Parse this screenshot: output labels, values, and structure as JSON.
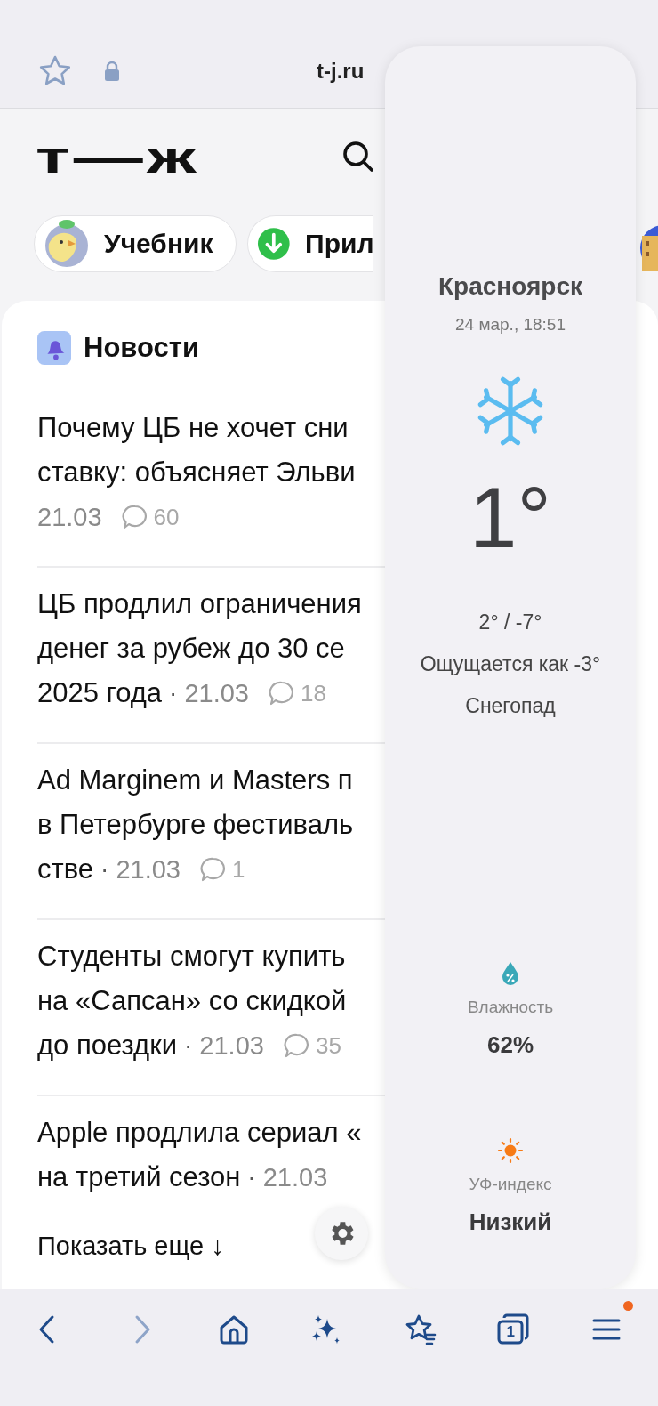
{
  "address_bar": {
    "url": "t-j.ru"
  },
  "header": {
    "logo": "т—ж"
  },
  "chips": [
    {
      "label": "Учебник",
      "kind": "avatar"
    },
    {
      "label": "Прил",
      "kind": "download"
    },
    {
      "kind": "partial"
    }
  ],
  "news": {
    "title": "Новости",
    "items": [
      {
        "lines": [
          "Почему ЦБ не хочет сни",
          "ставку: объясняет Эльви"
        ],
        "date": "21.03",
        "comments": "60"
      },
      {
        "lines": [
          "ЦБ продлил ограничения",
          "денег за рубеж до 30 се"
        ],
        "tail": "2025 года",
        "separator": "·",
        "date": "21.03",
        "comments": "18"
      },
      {
        "lines": [
          "Ad Marginem и Masters п",
          "в Петербурге фестиваль"
        ],
        "tail": "стве",
        "separator": "·",
        "date": "21.03",
        "comments": "1"
      },
      {
        "lines": [
          "Студенты смогут купить",
          "на «Сапсан» со скидкой"
        ],
        "tail": "до поездки",
        "separator": "·",
        "date": "21.03",
        "comments": "35"
      },
      {
        "lines": [
          "Apple продлила сериал «"
        ],
        "tail": "на третий сезон",
        "separator": "·",
        "date": "21.03"
      }
    ],
    "more": "Показать еще ↓"
  },
  "weather": {
    "city": "Красноярск",
    "time": "24 мар., 18:51",
    "temperature": "1°",
    "range": "2° / -7°",
    "feels_like": "Ощущается как -3°",
    "condition": "Снегопад",
    "details": [
      {
        "kind": "humidity",
        "label": "Влажность",
        "value": "62%"
      },
      {
        "kind": "uv",
        "label": "УФ-индекс",
        "value": "Низкий"
      }
    ]
  },
  "bottom_bar": {
    "tabs_count": "1",
    "menu_notification": true
  }
}
